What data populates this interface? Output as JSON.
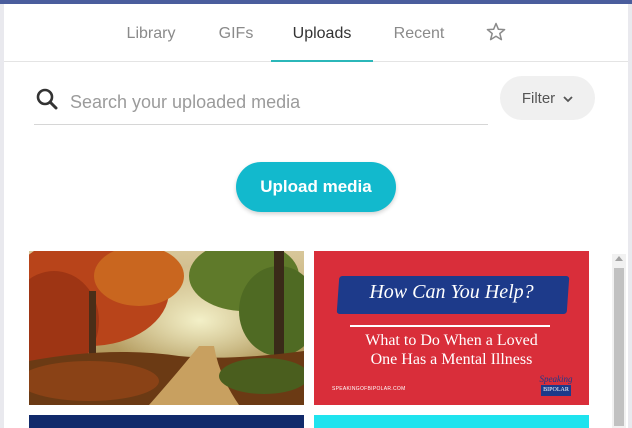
{
  "tabs": [
    {
      "label": "Library",
      "active": false
    },
    {
      "label": "GIFs",
      "active": false
    },
    {
      "label": "Uploads",
      "active": true
    },
    {
      "label": "Recent",
      "active": false
    }
  ],
  "tab_icon": "star-icon",
  "search": {
    "placeholder": "Search your uploaded media",
    "value": "",
    "icon": "search-icon"
  },
  "filter": {
    "label": "Filter",
    "icon": "chevron-down-icon"
  },
  "upload": {
    "label": "Upload media"
  },
  "thumbnails": [
    {
      "kind": "photo",
      "subject": "autumn forest path"
    },
    {
      "kind": "graphic",
      "headline": "How Can You Help?",
      "line1": "What to Do When a Loved",
      "line2": "One Has a Mental Illness",
      "site": "SPEAKINGOFBIPOLAR.COM",
      "logo_top": "Speaking",
      "logo_bottom": "BIPOLAR"
    },
    {
      "kind": "graphic",
      "color": "#112a6b"
    },
    {
      "kind": "graphic",
      "color": "#1fe3ee"
    }
  ],
  "colors": {
    "accent": "#2bb7b9",
    "button": "#12b9cd",
    "topbar": "#4a5d9d"
  }
}
